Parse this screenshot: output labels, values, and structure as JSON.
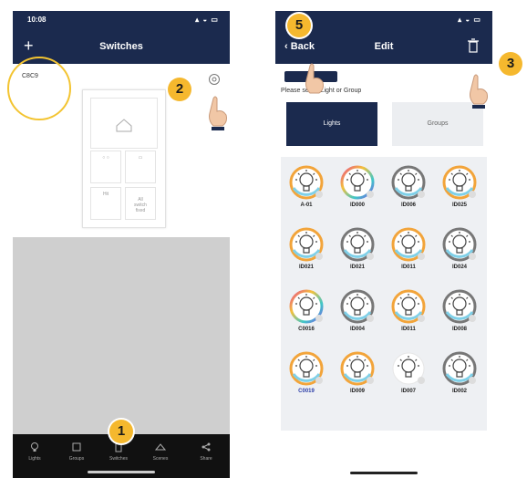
{
  "left_phone": {
    "status_time": "10:08",
    "status_icons": "▴ ◒ ▭",
    "nav_title": "Switches",
    "plus_glyph": "+",
    "switch_id": "C8C9",
    "panel_cells": [
      "○ ○",
      "▭",
      "Hit",
      "All\nswitch\nfixed"
    ],
    "tabs": [
      {
        "label": "Lights",
        "icon": "bulb-icon"
      },
      {
        "label": "Groups",
        "icon": "groups-icon"
      },
      {
        "label": "Switches",
        "icon": "switch-icon"
      },
      {
        "label": "Scenes",
        "icon": "scenes-icon"
      },
      {
        "label": "Share",
        "icon": "share-icon"
      }
    ]
  },
  "right_phone": {
    "status_time": "",
    "status_icons": "▴ ◒ ▭",
    "back_label": "‹ Back",
    "nav_title": "Edit",
    "hint": "Please select Light or Group",
    "segments": {
      "lights": "Lights",
      "groups": "Groups"
    },
    "bulbs": [
      {
        "label": "A-01",
        "ring": "#f2a43a"
      },
      {
        "label": "ID000",
        "ring": "rainbow"
      },
      {
        "label": "ID006",
        "ring": "#777777"
      },
      {
        "label": "ID025",
        "ring": "#f2a43a"
      },
      {
        "label": "ID021",
        "ring": "#f2a43a"
      },
      {
        "label": "ID021",
        "ring": "#777777"
      },
      {
        "label": "ID011",
        "ring": "#f2a43a"
      },
      {
        "label": "ID024",
        "ring": "#777777"
      },
      {
        "label": "C0016",
        "ring": "rainbow"
      },
      {
        "label": "ID004",
        "ring": "#777777"
      },
      {
        "label": "ID011",
        "ring": "#f2a43a"
      },
      {
        "label": "ID008",
        "ring": "#777777"
      },
      {
        "label": "C0019",
        "ring": "#f2a43a",
        "blue": true
      },
      {
        "label": "ID009",
        "ring": "#f2a43a"
      },
      {
        "label": "ID007",
        "ring": "#ffffff"
      },
      {
        "label": "ID002",
        "ring": "#777777"
      }
    ]
  },
  "callouts": {
    "c1": "1",
    "c2": "2",
    "c3": "3",
    "c5": "5"
  },
  "colors": {
    "navy": "#1b2a4e",
    "accent": "#f5b82e",
    "gray_area": "#cfcfcf"
  }
}
